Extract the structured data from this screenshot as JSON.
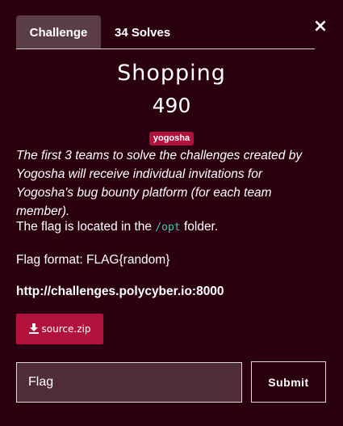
{
  "modal": {
    "close_label": "×"
  },
  "tabs": [
    {
      "label": "Challenge",
      "active": true
    },
    {
      "label": "34 Solves",
      "active": false
    }
  ],
  "challenge": {
    "name": "Shopping",
    "value": "490",
    "tag": "yogosha",
    "description_italic": "The first 3 teams to solve the challenges created by Yogosha will receive individual invitations for Yogosha's bug bounty platform (for each team member).",
    "location_prefix": "The flag is located in the ",
    "location_code": "/opt",
    "location_suffix": " folder.",
    "flag_format": "Flag format: FLAG{random}",
    "url": "http://challenges.polycyber.io:8000"
  },
  "files": [
    {
      "icon": "download-icon",
      "label": "source.zip"
    }
  ],
  "submission": {
    "input_placeholder": "Flag",
    "input_value": "",
    "submit_label": "Submit"
  },
  "colors": {
    "background": "#2b0112",
    "accent": "#b1123b",
    "active_tab": "#5a3d47",
    "code": "#35d0b0"
  }
}
